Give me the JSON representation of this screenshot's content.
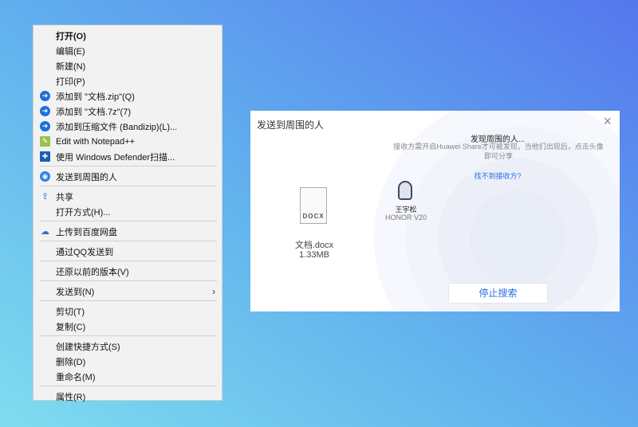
{
  "menu": {
    "items": [
      {
        "label": "打开(O)",
        "bold": true
      },
      {
        "label": "编辑(E)"
      },
      {
        "label": "新建(N)"
      },
      {
        "label": "打印(P)"
      },
      {
        "label": "添加到 \"文档.zip\"(Q)",
        "icon": "bandizip-icon"
      },
      {
        "label": "添加到 \"文档.7z\"(7)",
        "icon": "bandizip-icon"
      },
      {
        "label": "添加到压缩文件 (Bandizip)(L)...",
        "icon": "bandizip-icon"
      },
      {
        "label": "Edit with Notepad++",
        "icon": "notepad-icon"
      },
      {
        "label": "使用 Windows Defender扫描...",
        "icon": "defender-icon"
      },
      {
        "sep": true
      },
      {
        "label": "发送到周围的人",
        "icon": "huawei-share-icon"
      },
      {
        "sep": true
      },
      {
        "label": "共享",
        "icon": "share-icon"
      },
      {
        "label": "打开方式(H)..."
      },
      {
        "sep": true
      },
      {
        "label": "上传到百度网盘",
        "icon": "baidu-pan-icon"
      },
      {
        "sep": true
      },
      {
        "label": "通过QQ发送到"
      },
      {
        "sep": true
      },
      {
        "label": "还原以前的版本(V)"
      },
      {
        "sep": true
      },
      {
        "label": "发送到(N)",
        "submenu": true
      },
      {
        "sep": true
      },
      {
        "label": "剪切(T)"
      },
      {
        "label": "复制(C)"
      },
      {
        "sep": true
      },
      {
        "label": "创建快捷方式(S)"
      },
      {
        "label": "删除(D)"
      },
      {
        "label": "重命名(M)"
      },
      {
        "sep": true
      },
      {
        "label": "属性(R)"
      }
    ]
  },
  "dialog": {
    "title": "发送到周围的人",
    "close": "×",
    "heading": "发现周围的人...",
    "desc": "接收方需开启Huawei Share才可被发现，当他们出现后，点击头像即可分享",
    "help_link": "找不到接收方?",
    "file": {
      "type_label": "DOCX",
      "name": "文档.docx",
      "size": "1.33MB"
    },
    "device": {
      "user": "王宇松",
      "model": "HONOR V20"
    },
    "stop_button": "停止搜索"
  }
}
